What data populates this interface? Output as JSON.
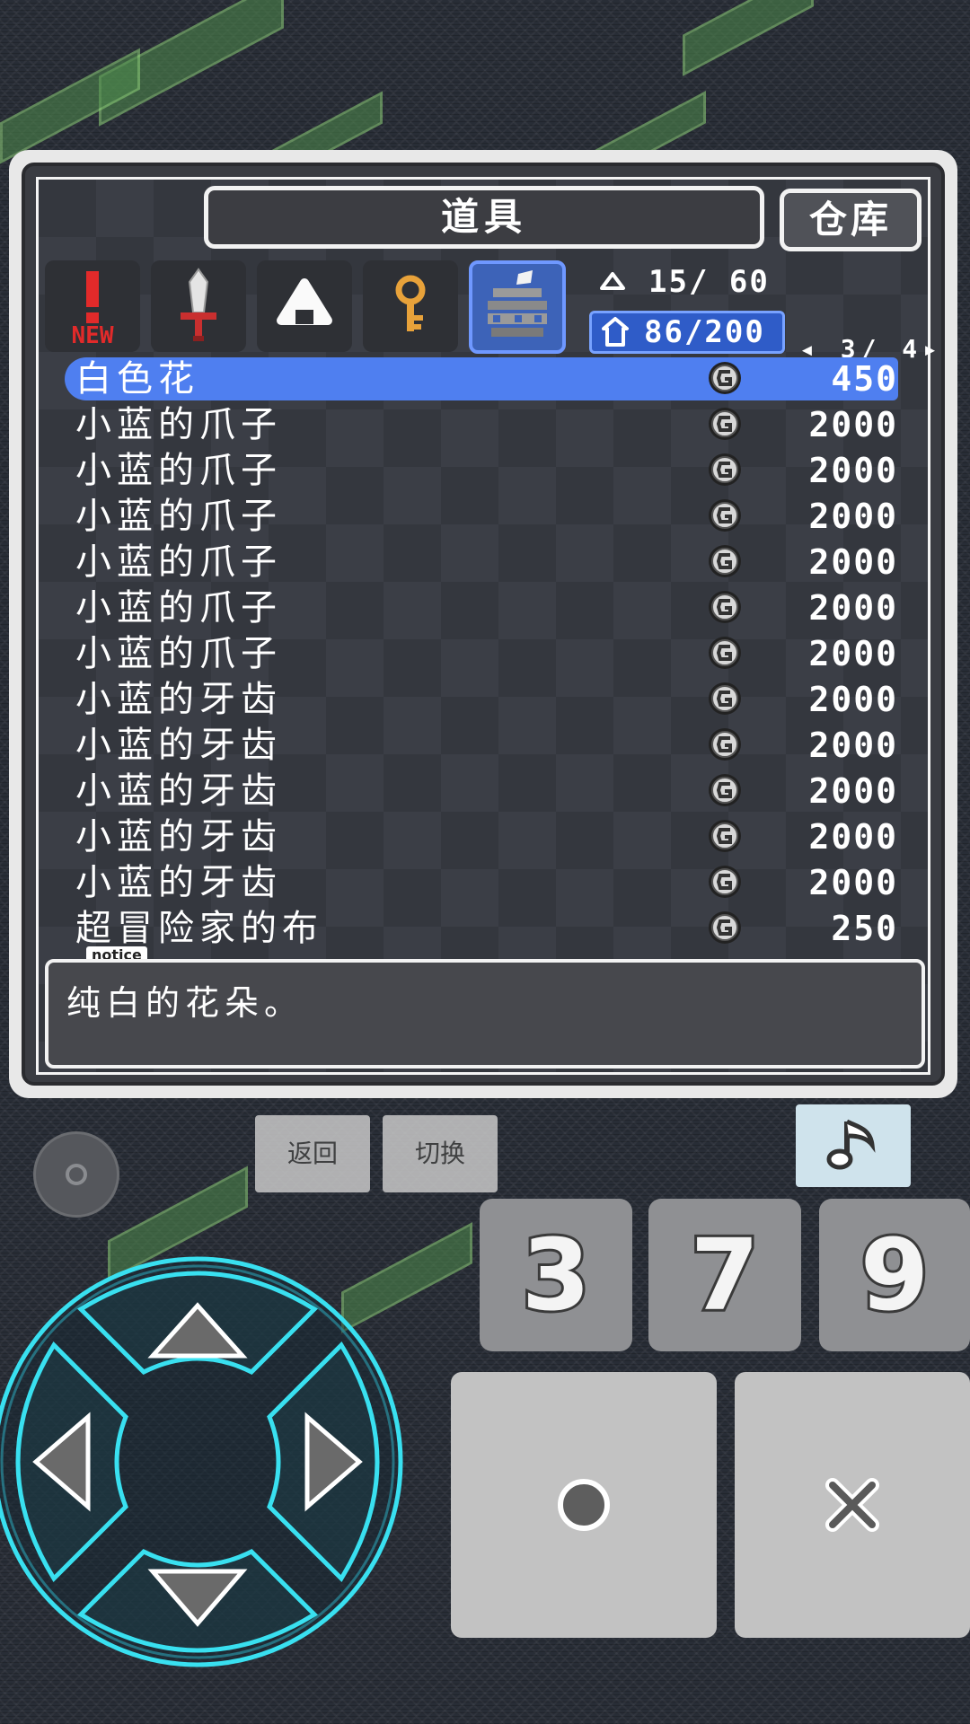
{
  "header": {
    "title": "道具",
    "warehouse_label": "仓库"
  },
  "tabs": [
    {
      "icon": "new-item-icon",
      "label": "NEW",
      "active": false
    },
    {
      "icon": "sword-icon",
      "active": false
    },
    {
      "icon": "rice-ball-icon",
      "active": false
    },
    {
      "icon": "key-icon",
      "active": false
    },
    {
      "icon": "materials-icon",
      "active": true
    }
  ],
  "stats": {
    "row1": {
      "icon": "rice-ball-small-icon",
      "value": "15/ 60"
    },
    "row2": {
      "icon": "bag-icon",
      "value": "86/200"
    },
    "pager": "◂ 3/ 4▸"
  },
  "items": [
    {
      "name": "白色花",
      "price": "450",
      "selected": true
    },
    {
      "name": "小蓝的爪子",
      "price": "2000"
    },
    {
      "name": "小蓝的爪子",
      "price": "2000"
    },
    {
      "name": "小蓝的爪子",
      "price": "2000"
    },
    {
      "name": "小蓝的爪子",
      "price": "2000"
    },
    {
      "name": "小蓝的爪子",
      "price": "2000"
    },
    {
      "name": "小蓝的爪子",
      "price": "2000"
    },
    {
      "name": "小蓝的牙齿",
      "price": "2000"
    },
    {
      "name": "小蓝的牙齿",
      "price": "2000"
    },
    {
      "name": "小蓝的牙齿",
      "price": "2000"
    },
    {
      "name": "小蓝的牙齿",
      "price": "2000"
    },
    {
      "name": "小蓝的牙齿",
      "price": "2000"
    },
    {
      "name": "超冒险家的布",
      "price": "250"
    }
  ],
  "notice": {
    "tag": "notice",
    "text": "纯白的花朵。"
  },
  "controls": {
    "back_label": "返回",
    "switch_label": "切换",
    "music_icon": "music-note-icon",
    "keys": [
      "3",
      "7",
      "9"
    ],
    "confirm_icon": "circle-icon",
    "cancel_icon": "cross-icon"
  },
  "colors": {
    "selection": "#4f7ff0",
    "active_tab": "#3d63b8",
    "dpad_glow": "#39e0f0"
  }
}
